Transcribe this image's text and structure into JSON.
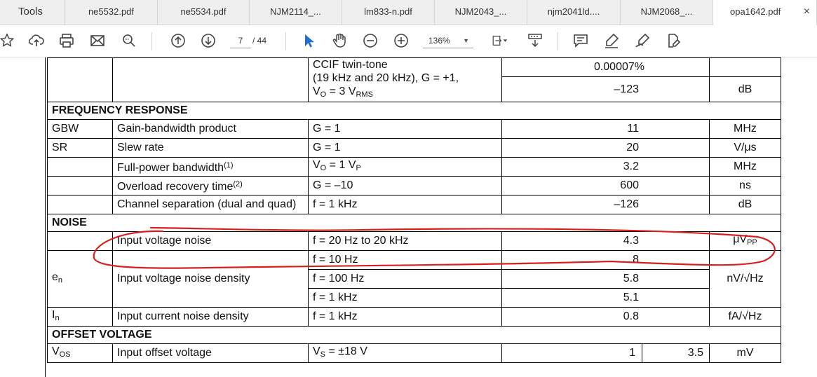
{
  "tabs": {
    "tools": "Tools",
    "files": [
      "ne5532.pdf",
      "ne5534.pdf",
      "NJM2114_...",
      "lm833-n.pdf",
      "NJM2043_...",
      "njm2041ld....",
      "NJM2068_...",
      "opa1642.pdf"
    ],
    "close_glyph": "×"
  },
  "toolbar": {
    "page_current": "7",
    "page_total": "/  44",
    "zoom": "136%",
    "icons": [
      "star-icon",
      "cloud-upload-icon",
      "print-icon",
      "mail-icon",
      "zoom-search-icon",
      "page-up-icon",
      "page-down-icon",
      "select-cursor-icon",
      "hand-icon",
      "zoom-out-icon",
      "zoom-in-icon",
      "fit-page-icon",
      "scroll-mode-icon",
      "comment-icon",
      "highlight-icon",
      "sign-icon",
      "fill-sign-icon"
    ]
  },
  "table": {
    "ccif_cond_1": "CCIF twin-tone",
    "ccif_cond_2": "(19 kHz and 20 kHz), G = +1,",
    "ccif_cond_3_a": "V",
    "ccif_cond_3_sub": "O",
    "ccif_cond_3_b": " = 3 V",
    "ccif_cond_3_sub2": "RMS",
    "ccif_val1": "0.00007%",
    "ccif_val2": "–123",
    "ccif_unit2": "dB",
    "sec_freq": "FREQUENCY RESPONSE",
    "gbw_sym": "GBW",
    "gbw_par": "Gain-bandwidth product",
    "gbw_cond": "G = 1",
    "gbw_typ": "11",
    "gbw_unit": "MHz",
    "sr_sym": "SR",
    "sr_par": "Slew rate",
    "sr_cond": "G = 1",
    "sr_typ": "20",
    "sr_unit": "V/μs",
    "fpb_par": "Full-power bandwidth",
    "fpb_sup": "(1)",
    "fpb_cond_a": "V",
    "fpb_cond_sub": "O",
    "fpb_cond_b": " = 1 V",
    "fpb_cond_sub2": "P",
    "fpb_typ": "3.2",
    "fpb_unit": "MHz",
    "ovr_par": "Overload recovery time",
    "ovr_sup": "(2)",
    "ovr_cond": "G = –10",
    "ovr_typ": "600",
    "ovr_unit": "ns",
    "chs_par": "Channel separation (dual and quad)",
    "chs_cond": "f = 1 kHz",
    "chs_typ": "–126",
    "chs_unit": "dB",
    "sec_noise": "NOISE",
    "ivn_par": "Input voltage noise",
    "ivn_cond": "f = 20 Hz to 20 kHz",
    "ivn_typ": "4.3",
    "ivn_unit_a": "μV",
    "ivn_unit_sub": "PP",
    "en_sym_a": "e",
    "en_sym_sub": "n",
    "en_par": "Input voltage noise density",
    "en_cond1": "f = 10 Hz",
    "en_typ1": "8",
    "en_cond2": "f = 100 Hz",
    "en_typ2": "5.8",
    "en_cond3": "f = 1 kHz",
    "en_typ3": "5.1",
    "en_unit": "nV/√Hz",
    "in_sym_a": "I",
    "in_sym_sub": "n",
    "in_par": "Input current noise density",
    "in_cond": "f = 1 kHz",
    "in_typ": "0.8",
    "in_unit": "fA/√Hz",
    "sec_offset": "OFFSET VOLTAGE",
    "vos_sym_a": "V",
    "vos_sym_sub": "OS",
    "vos_par": "Input offset voltage",
    "vos_cond_a": "V",
    "vos_cond_sub": "S",
    "vos_cond_b": " = ±18 V",
    "vos_typ": "1",
    "vos_max": "3.5",
    "vos_unit": "mV"
  },
  "colors": {
    "annotation": "#d61f1f",
    "tab_bg": "#efefef",
    "active_tab_bg": "#ffffff"
  }
}
